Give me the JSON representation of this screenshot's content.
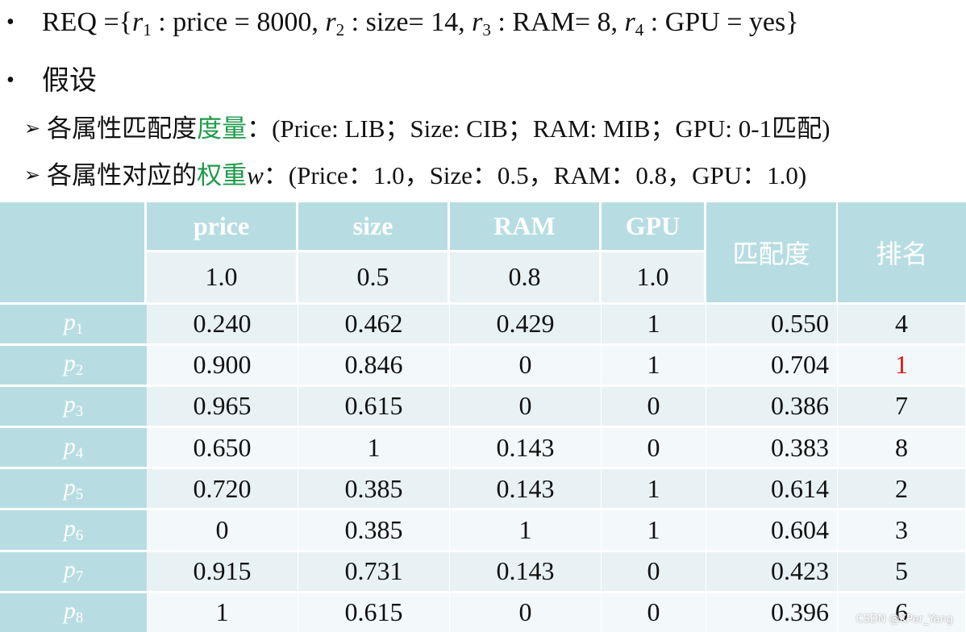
{
  "req": {
    "prefix": "REQ ={",
    "r1": "r",
    "r1_sub": "1",
    "t1": " : price = 8000, ",
    "r2": "r",
    "r2_sub": "2",
    "t2": " : size= 14, ",
    "r3": "r",
    "r3_sub": "3",
    "t3": " : RAM= 8, ",
    "r4": "r",
    "r4_sub": "4",
    "t4": " : GPU = yes}"
  },
  "assumption_title": "假设",
  "measure_line": {
    "lead": "各属性匹配度",
    "green": "度量",
    "rest": "：(Price: LIB；Size: CIB；RAM: MIB；GPU: 0-1匹配)"
  },
  "weight_line": {
    "lead": "各属性对应的",
    "green": "权重",
    "var": "w",
    "rest": "：(Price：1.0，Size：0.5，RAM：0.8，GPU：1.0)"
  },
  "table": {
    "headers": [
      "price",
      "size",
      "RAM",
      "GPU"
    ],
    "weights": [
      "1.0",
      "0.5",
      "0.8",
      "1.0"
    ],
    "match_header": "匹配度",
    "rank_header": "排名",
    "rows": [
      {
        "p": "p",
        "sub": "1",
        "vals": [
          "0.240",
          "0.462",
          "0.429",
          "1"
        ],
        "match": "0.550",
        "rank": "4"
      },
      {
        "p": "p",
        "sub": "2",
        "vals": [
          "0.900",
          "0.846",
          "0",
          "1"
        ],
        "match": "0.704",
        "rank": "1"
      },
      {
        "p": "p",
        "sub": "3",
        "vals": [
          "0.965",
          "0.615",
          "0",
          "0"
        ],
        "match": "0.386",
        "rank": "7"
      },
      {
        "p": "p",
        "sub": "4",
        "vals": [
          "0.650",
          "1",
          "0.143",
          "0"
        ],
        "match": "0.383",
        "rank": "8"
      },
      {
        "p": "p",
        "sub": "5",
        "vals": [
          "0.720",
          "0.385",
          "0.143",
          "1"
        ],
        "match": "0.614",
        "rank": "2"
      },
      {
        "p": "p",
        "sub": "6",
        "vals": [
          "0",
          "0.385",
          "1",
          "1"
        ],
        "match": "0.604",
        "rank": "3"
      },
      {
        "p": "p",
        "sub": "7",
        "vals": [
          "0.915",
          "0.731",
          "0.143",
          "0"
        ],
        "match": "0.423",
        "rank": "5"
      },
      {
        "p": "p",
        "sub": "8",
        "vals": [
          "1",
          "0.615",
          "0",
          "0"
        ],
        "match": "0.396",
        "rank": "6"
      }
    ]
  },
  "watermark": "CSDN @KPer_Yang",
  "colors": {
    "header_bg": "#b7dde2",
    "row_light": "#e8f2f4",
    "row_lighter": "#f3f8fa",
    "green": "#1f9a4a",
    "highlight_red": "#dd1111"
  }
}
